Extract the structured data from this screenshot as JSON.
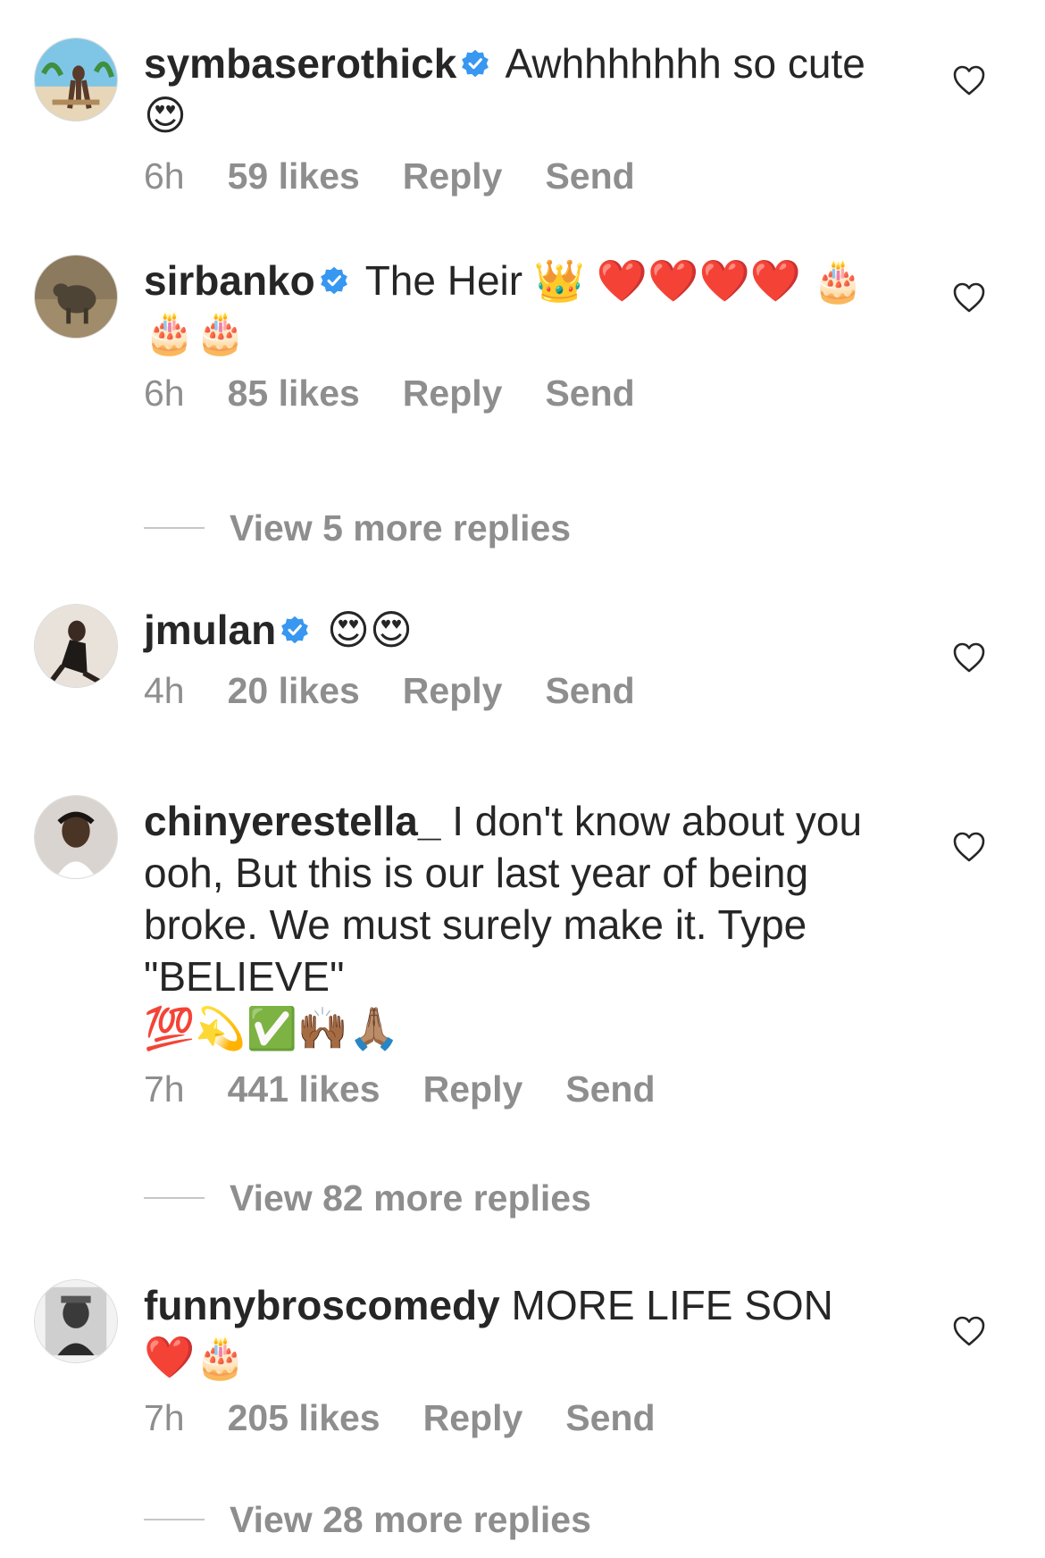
{
  "comments": [
    {
      "username": "symbaserothick",
      "verified": true,
      "text": "Awhhhhhhh so cute 😍",
      "time": "6h",
      "likes": "59 likes",
      "reply": "Reply",
      "send": "Send"
    },
    {
      "username": "sirbanko",
      "verified": true,
      "text": "The Heir 👑 ❤️❤️❤️❤️ 🎂🎂🎂",
      "time": "6h",
      "likes": "85 likes",
      "reply": "Reply",
      "send": "Send",
      "view_replies": "View 5 more replies"
    },
    {
      "username": "jmulan",
      "verified": true,
      "text": "😍😍",
      "time": "4h",
      "likes": "20 likes",
      "reply": "Reply",
      "send": "Send"
    },
    {
      "username": "chinyerestella_",
      "verified": false,
      "text": "I don't know about you ooh, But this is our last year of being broke. We must surely make it. Type \"BELIEVE\"",
      "text_emoji": "💯💫✅🙌🏾🙏🏽",
      "time": "7h",
      "likes": "441 likes",
      "reply": "Reply",
      "send": "Send",
      "view_replies": "View 82 more replies"
    },
    {
      "username": "funnybroscomedy",
      "verified": false,
      "text": "MORE LIFE SON",
      "text_emoji": "❤️🎂",
      "time": "7h",
      "likes": "205 likes",
      "reply": "Reply",
      "send": "Send",
      "view_replies": "View 28 more replies"
    }
  ],
  "icons": {
    "verified": "verified-badge-icon",
    "like": "heart-outline-icon"
  },
  "colors": {
    "text": "#262626",
    "secondary": "#8e8e8e",
    "verified_blue": "#3897f0"
  }
}
